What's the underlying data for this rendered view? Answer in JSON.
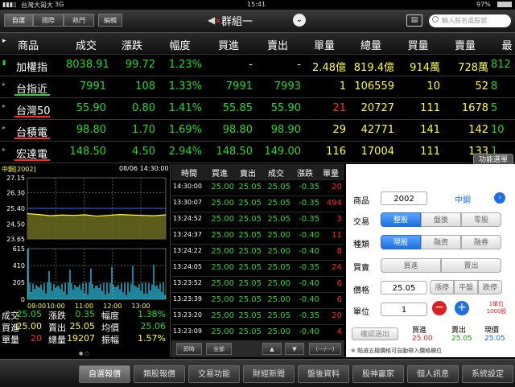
{
  "status": {
    "carrier": "台灣大哥大",
    "network": "3G",
    "time": "15:41",
    "battery": "97%"
  },
  "toolbar": {
    "segments": [
      "自選",
      "國際",
      "熱門"
    ],
    "edit_label": "編輯",
    "group_title": "群組一",
    "search_placeholder": "輸入股名或股號"
  },
  "quote": {
    "headers": [
      "商品",
      "成交",
      "漲跌",
      "幅度",
      "買進",
      "賣出",
      "單量",
      "總量",
      "買量",
      "賣量",
      "最"
    ],
    "rows": [
      {
        "name": "加權指",
        "price": "8038.91",
        "chg": "99.72",
        "pct": "1.23%",
        "bid": "-",
        "ask": "-",
        "vol": "2.48億",
        "total": "819.4億",
        "bidvol": "914萬",
        "askvol": "728萬",
        "high": "812"
      },
      {
        "name": "台指近",
        "price": "7991",
        "chg": "108",
        "pct": "1.33%",
        "bid": "7991",
        "ask": "7993",
        "vol": "1",
        "total": "106559",
        "bidvol": "10",
        "askvol": "52",
        "high": "8"
      },
      {
        "name": "台灣50",
        "price": "55.90",
        "chg": "0.80",
        "pct": "1.41%",
        "bid": "55.85",
        "ask": "55.90",
        "vol": "21",
        "total": "20727",
        "bidvol": "111",
        "askvol": "1678",
        "high": "5"
      },
      {
        "name": "台積電",
        "price": "98.80",
        "chg": "1.70",
        "pct": "1.69%",
        "bid": "98.80",
        "ask": "98.90",
        "vol": "29",
        "total": "42771",
        "bidvol": "141",
        "askvol": "142",
        "high": "10"
      },
      {
        "name": "宏達電",
        "price": "148.50",
        "chg": "4.50",
        "pct": "2.94%",
        "bid": "148.50",
        "ask": "149.00",
        "vol": "116",
        "total": "17004",
        "bidvol": "111",
        "askvol": "133",
        "high": "1"
      }
    ],
    "func_label": "功能選單"
  },
  "chart": {
    "title": "中鋼[2002]",
    "timestamp": "08/06 14:30:00",
    "price_ticks": [
      "27.15",
      "26.30",
      "25.40",
      "24.50",
      "23.65"
    ],
    "volume_ticks": [
      "615",
      "410",
      "205",
      "0"
    ],
    "time_ticks": [
      "09:00",
      "10:00",
      "11:00",
      "12:00",
      "13:00"
    ],
    "ref_price": 25.4,
    "stats": [
      {
        "label": "成交",
        "value": "25.05",
        "label2": "漲跌",
        "value2": "0.35",
        "label3": "幅度",
        "value3": "1.38%"
      },
      {
        "label": "買進",
        "value": "25.00",
        "label2": "賣出",
        "value2": "25.05",
        "label3": "均價",
        "value3": "25.06"
      },
      {
        "label": "單量",
        "value": "20",
        "label2": "總量",
        "value2": "19207",
        "label3": "振幅",
        "value3": "1.57%"
      }
    ]
  },
  "chart_data": {
    "type": "line",
    "title": "中鋼[2002]",
    "x": [
      "09:00",
      "10:00",
      "11:00",
      "12:00",
      "13:00"
    ],
    "series": [
      {
        "values": [
          25.1,
          25.05,
          24.98,
          25.02,
          25.0,
          25.03,
          24.96,
          25.0,
          25.05,
          25.02,
          25.0,
          24.98,
          25.03
        ]
      }
    ],
    "ylim": [
      23.65,
      27.15
    ],
    "volume_ylim": [
      0,
      615
    ],
    "grid": true
  },
  "trades": {
    "headers": [
      "時間",
      "買進",
      "賣出",
      "成交",
      "漲跌",
      "單量"
    ],
    "rows": [
      [
        "14:30:00",
        "25.00",
        "25.05",
        "25.05",
        "-0.35",
        "20"
      ],
      [
        "13:30:07",
        "25.00",
        "25.05",
        "25.05",
        "-0.35",
        "494"
      ],
      [
        "13:24:52",
        "25.00",
        "25.05",
        "25.05",
        "-0.35",
        "3"
      ],
      [
        "13:24:37",
        "25.00",
        "25.05",
        "25.00",
        "-0.40",
        "11"
      ],
      [
        "13:24:22",
        "25.00",
        "25.05",
        "25.00",
        "-0.40",
        "8"
      ],
      [
        "13:24:05",
        "25.00",
        "25.05",
        "25.05",
        "-0.35",
        "24"
      ],
      [
        "13:23:52",
        "25.00",
        "25.05",
        "25.00",
        "-0.40",
        "6"
      ],
      [
        "13:23:39",
        "25.00",
        "25.05",
        "25.00",
        "-0.40",
        "6"
      ],
      [
        "13:23:20",
        "25.00",
        "25.05",
        "25.05",
        "-0.35",
        "20"
      ],
      [
        "13:23:09",
        "25.00",
        "25.05",
        "25.00",
        "-0.40",
        "4"
      ]
    ],
    "foot": {
      "realtime": "即時",
      "all": "全部",
      "page": "(---/---)"
    }
  },
  "order": {
    "labels": {
      "product": "商品",
      "trade": "交易",
      "kind": "種類",
      "side": "買賣",
      "price": "價格",
      "unit": "單位"
    },
    "product_code": "2002",
    "product_name": "中鋼",
    "trade_opts": [
      "整股",
      "盤後",
      "零股"
    ],
    "kind_opts": [
      "現股",
      "融資",
      "融券"
    ],
    "side_opts": [
      "買進",
      "賣出"
    ],
    "price": "25.05",
    "price_opts": [
      "漲停",
      "平盤",
      "跌停"
    ],
    "unit": "1",
    "unit_note": "1單位\n1000股",
    "submit_label": "確認送出",
    "summary_headers": [
      "買進",
      "賣出",
      "現價"
    ],
    "summary_values": [
      "25.00",
      "25.05",
      "25.05"
    ],
    "hint": "※ 點選五檔價格可自動帶入價格欄位"
  },
  "tabs": [
    "自選報價",
    "類股報價",
    "交易功能",
    "財經新聞",
    "盤後資料",
    "股神贏家",
    "個人訊息",
    "系統設定"
  ],
  "colors": {
    "up": "#ff2a2a",
    "down": "#27d827",
    "yellow": "#ffff33",
    "cyan": "#33ddff",
    "accent": "#1f6fe0"
  }
}
